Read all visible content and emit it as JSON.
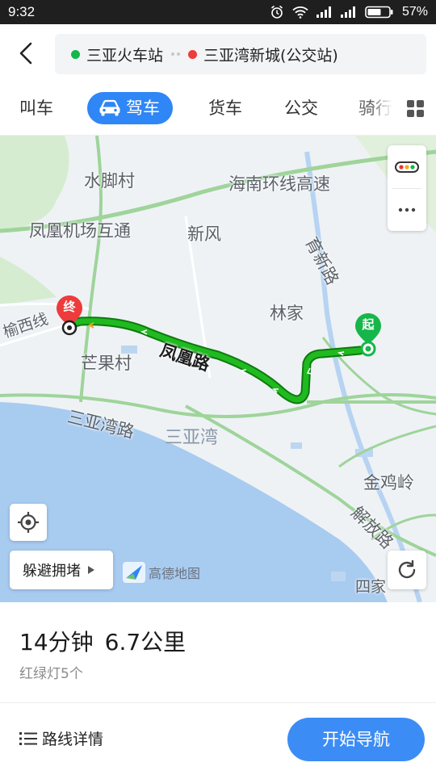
{
  "status_bar": {
    "time": "9:32",
    "battery": "57%"
  },
  "header": {
    "origin": "三亚火车站",
    "destination": "三亚湾新城(公交站)"
  },
  "tabs": [
    {
      "label": "叫车",
      "active": false
    },
    {
      "label": "驾车",
      "active": true
    },
    {
      "label": "货车",
      "active": false
    },
    {
      "label": "公交",
      "active": false
    },
    {
      "label": "骑行",
      "active": false
    }
  ],
  "map": {
    "labels": {
      "shuijiao": "水脚村",
      "hainan_ring": "海南环线高速",
      "fenghuang_airport": "凤凰机场互通",
      "xinfeng": "新风",
      "yuxin_road": "育新路",
      "linjia": "林家",
      "yuyu_west": "榆西线",
      "mangguo": "芒果村",
      "fenghuang_road": "凤凰路",
      "sanyawan_road": "三亚湾路",
      "sanyawan": "三亚湾",
      "jinjiling": "金鸡岭",
      "jiefang_road": "解放路",
      "sijia": "四家"
    },
    "start_marker": "起",
    "end_marker": "终",
    "avoid_label": "躲避拥堵",
    "logo_text": "高德地图"
  },
  "route": {
    "duration": "14分钟",
    "distance": "6.7公里",
    "traffic_lights": "红绿灯5个"
  },
  "bottom": {
    "details_label": "路线详情",
    "start_nav_label": "开始导航"
  },
  "colors": {
    "accent": "#2f86f6",
    "route": "#1aa31a",
    "start": "#16b64a",
    "end": "#ee3b3b"
  }
}
